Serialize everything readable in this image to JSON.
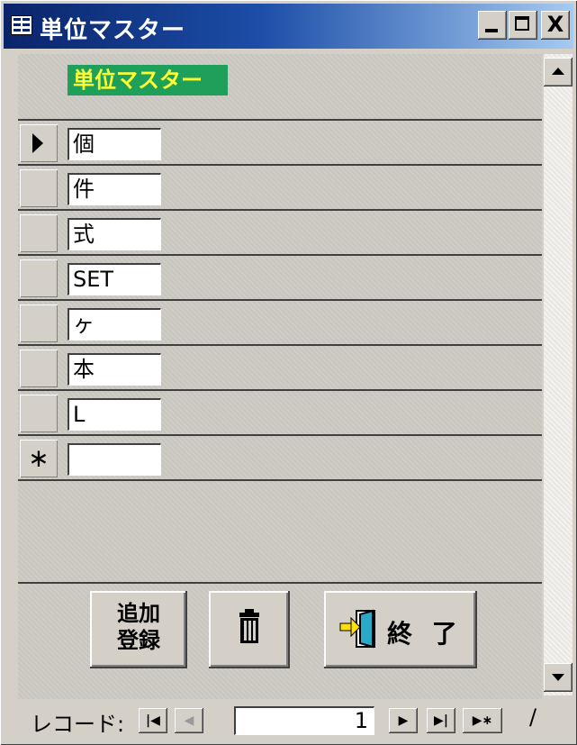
{
  "window": {
    "title": "単位マスター",
    "icon": "form-icon",
    "controls": {
      "minimize": "_",
      "maximize": "□",
      "close": "X"
    }
  },
  "form": {
    "header_label": "単位マスター",
    "header_label_bg": "#1ea05a",
    "header_label_color": "#ffff33",
    "records": [
      {
        "value": "個",
        "selector": "current"
      },
      {
        "value": "件",
        "selector": "none"
      },
      {
        "value": "式",
        "selector": "none"
      },
      {
        "value": "SET",
        "selector": "none"
      },
      {
        "value": "ヶ",
        "selector": "none"
      },
      {
        "value": "本",
        "selector": "none"
      },
      {
        "value": "L",
        "selector": "none"
      },
      {
        "value": "",
        "selector": "new"
      }
    ],
    "new_row_marker": "∗"
  },
  "buttons": {
    "add_line1": "追加",
    "add_line2": "登録",
    "delete_icon": "trash-icon",
    "exit_label": "終 了",
    "exit_icon": "exit-door-icon"
  },
  "navigation": {
    "label": "レコード:",
    "first": "|◀",
    "prev": "◀",
    "current": "1",
    "next": "▶",
    "last": "▶|",
    "new": "▶∗",
    "of": "/"
  }
}
